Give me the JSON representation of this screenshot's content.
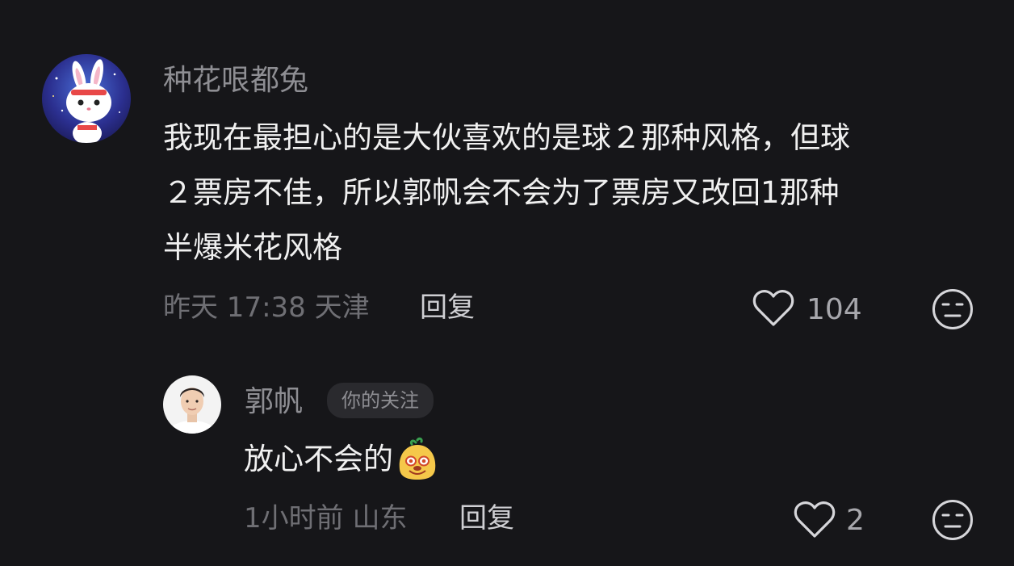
{
  "comment": {
    "username": "种花哏都兔",
    "text_line1": "我现在最担心的是大伙喜欢的是球２那种风格，但球",
    "text_line2": "２票房不佳，所以郭帆会不会为了票房又改回1那种",
    "text_line3": "半爆米花风格",
    "time_location": "昨天 17:38 天津",
    "reply_label": "回复",
    "likes": "104",
    "avatar_icon": "rabbit-avatar-icon",
    "like_icon": "heart-icon",
    "reaction_icon": "neutral-face-icon"
  },
  "reply": {
    "username": "郭帆",
    "badge": "你的关注",
    "text": "放心不会的",
    "emoji_icon": "smiling-blob-emoji-icon",
    "time_location": "1小时前 山东",
    "reply_label": "回复",
    "likes": "2",
    "avatar_icon": "man-avatar-icon",
    "like_icon": "heart-icon",
    "reaction_icon": "neutral-face-icon"
  },
  "colors": {
    "background": "#161619",
    "primary_text": "#f0f0f0",
    "secondary_text": "#8e8e93",
    "badge_bg": "#2a2a2e"
  }
}
